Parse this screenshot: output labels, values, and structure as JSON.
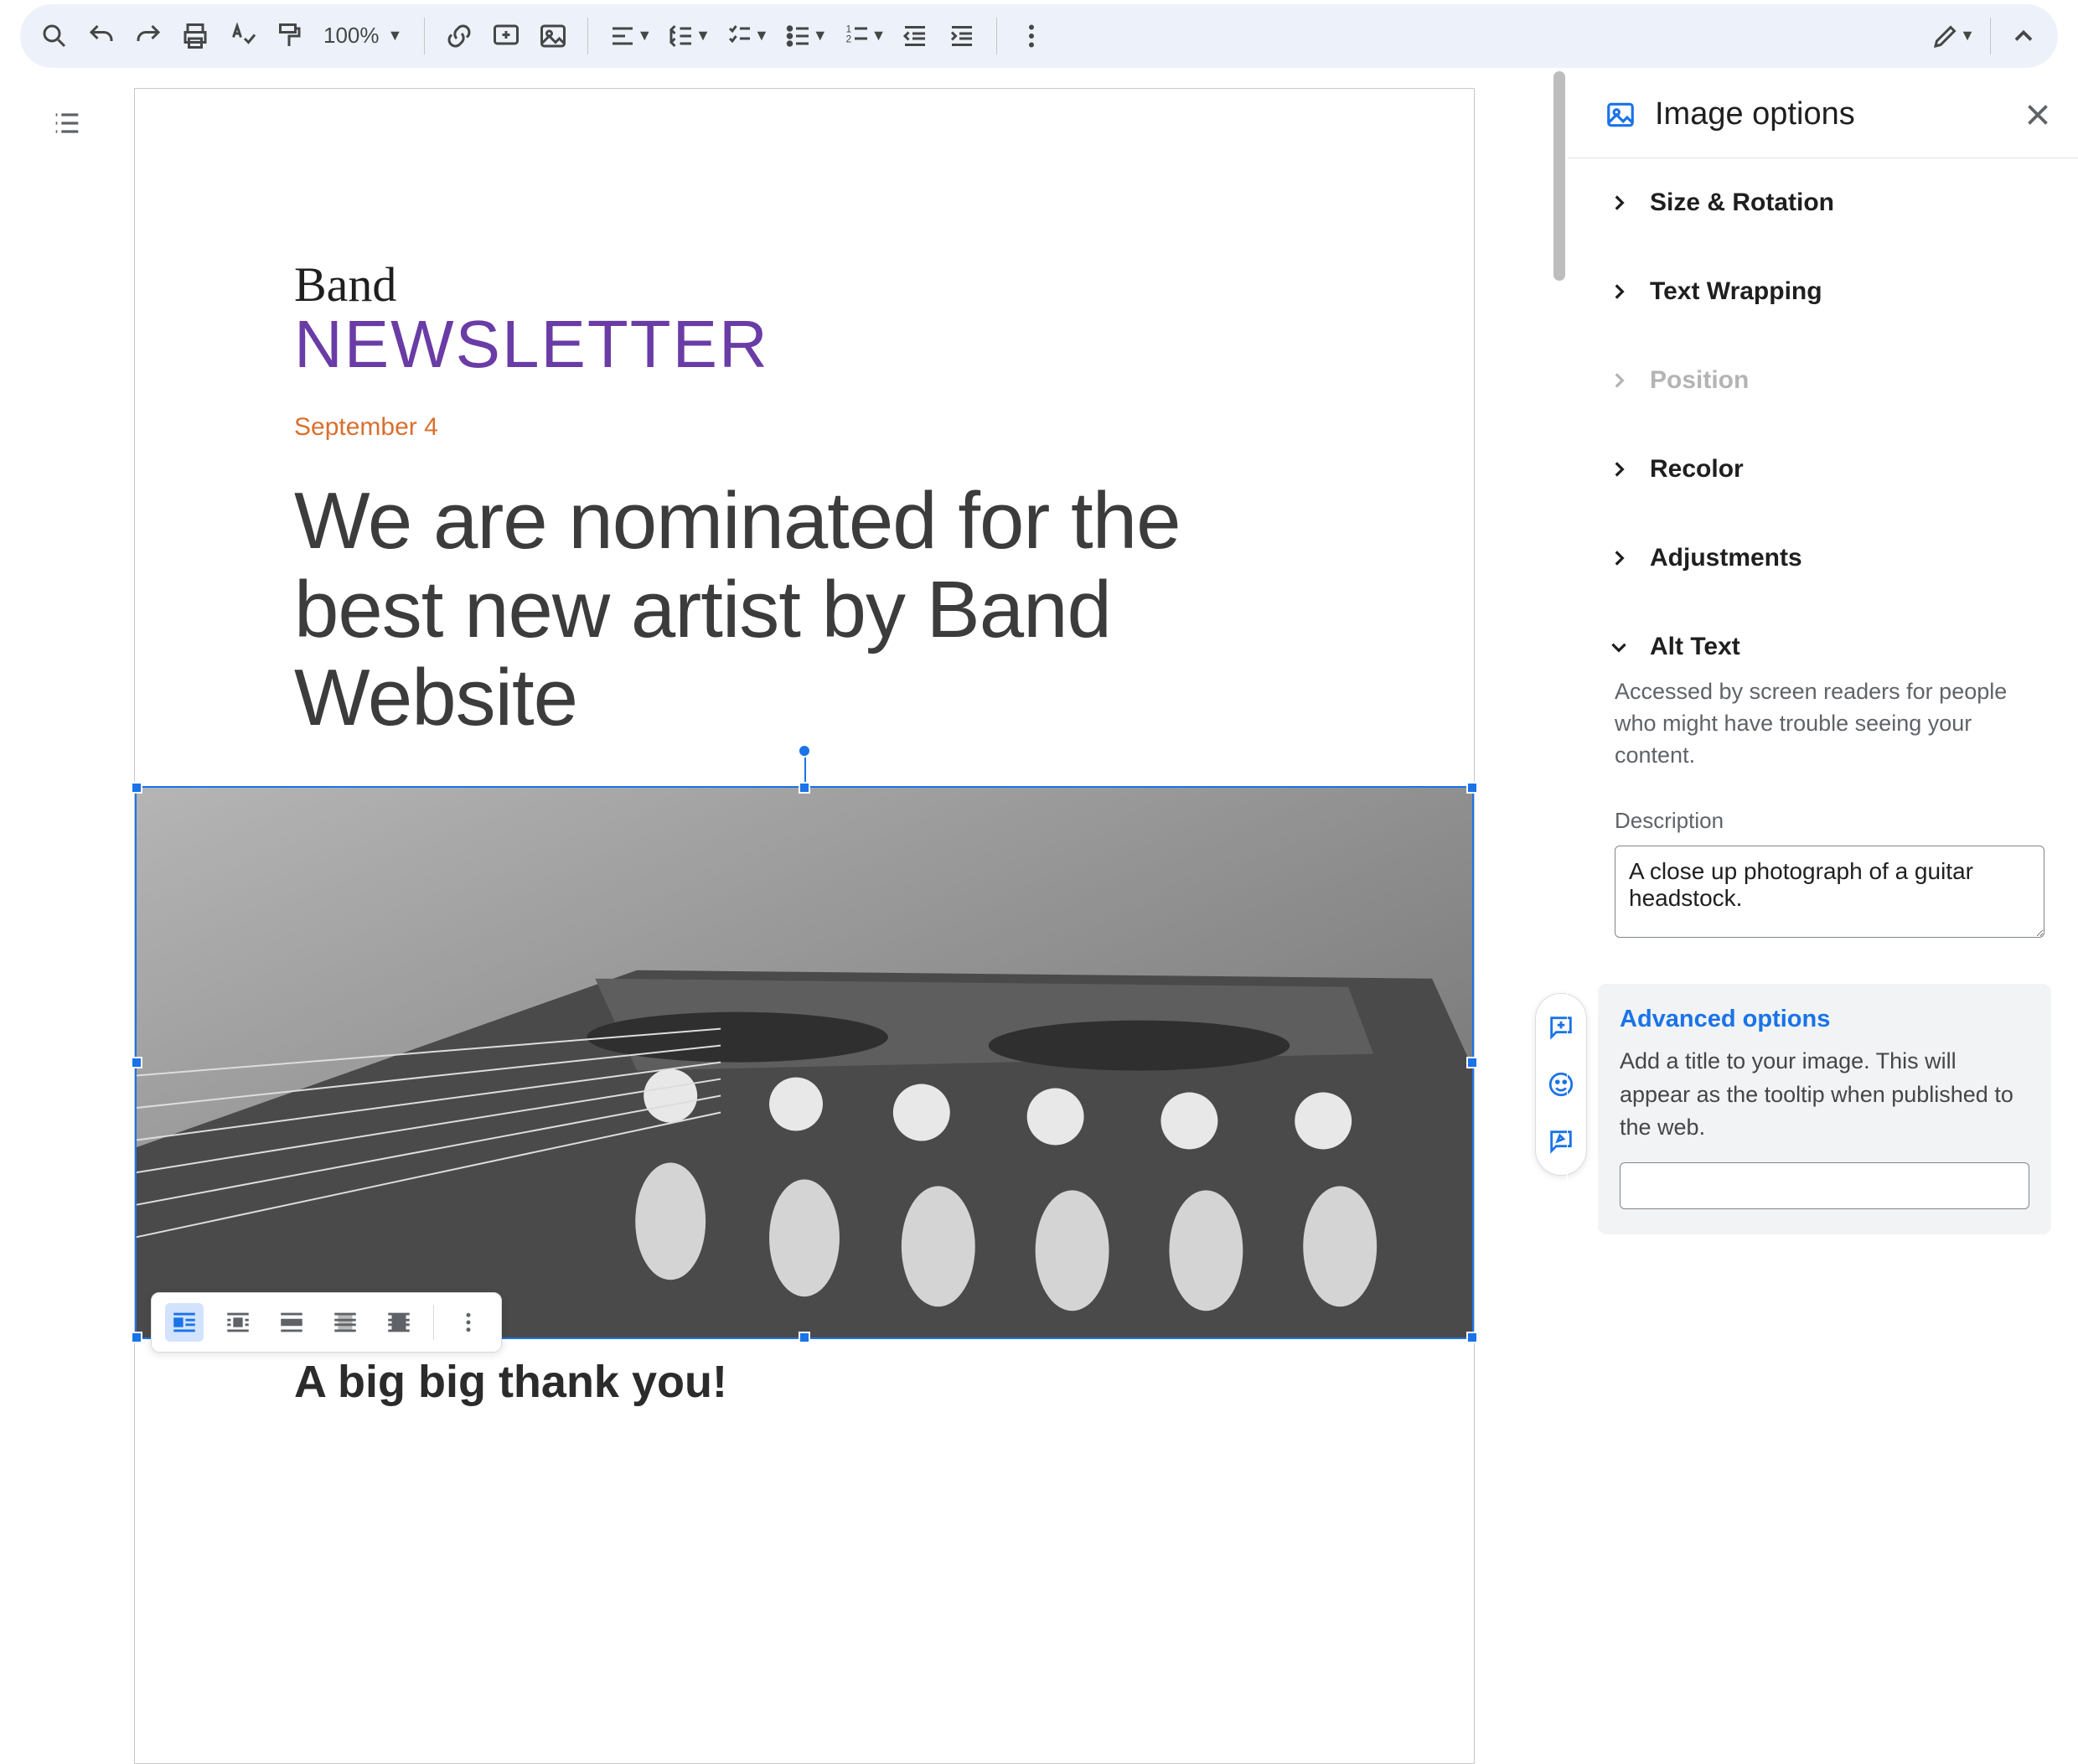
{
  "toolbar": {
    "zoom": "100%"
  },
  "document": {
    "script_title": "Band",
    "newsletter": "NEWSLETTER",
    "date": "September 4",
    "headline": "We are nominated for the best new artist by Band Website",
    "thanks": "A big big thank you!"
  },
  "sidebar": {
    "title": "Image options",
    "sections": {
      "size_rotation": "Size & Rotation",
      "text_wrapping": "Text Wrapping",
      "position": "Position",
      "recolor": "Recolor",
      "adjustments": "Adjustments",
      "alt_text": "Alt Text"
    },
    "alt": {
      "help": "Accessed by screen readers for people who might have trouble seeing your content.",
      "desc_label": "Description",
      "desc_value": "A close up photograph of a guitar headstock."
    },
    "advanced": {
      "title": "Advanced options",
      "help": "Add a title to your image. This will appear as the tooltip when published to the web.",
      "value": ""
    }
  }
}
